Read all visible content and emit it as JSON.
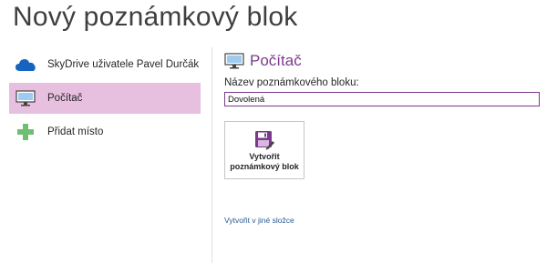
{
  "page": {
    "title": "Nový poznámkový blok"
  },
  "places": [
    {
      "label": "SkyDrive uživatele Pavel Durčák",
      "icon": "cloud-icon",
      "selected": false
    },
    {
      "label": "Počítač",
      "icon": "computer-icon",
      "selected": true
    },
    {
      "label": "Přidat místo",
      "icon": "plus-icon",
      "selected": false
    }
  ],
  "location": {
    "title": "Počítač",
    "name_label": "Název poznámkového bloku:",
    "name_value": "Dovolená",
    "create_line1": "Vytvořit",
    "create_line2": "poznámkový blok",
    "other_folder": "Vytvořit v jiné složce"
  },
  "colors": {
    "accent": "#7b3a8c",
    "selected_bg": "#e7bfdf",
    "cloud": "#1565c0",
    "plus": "#6fbf73",
    "link": "#2a5a93"
  }
}
